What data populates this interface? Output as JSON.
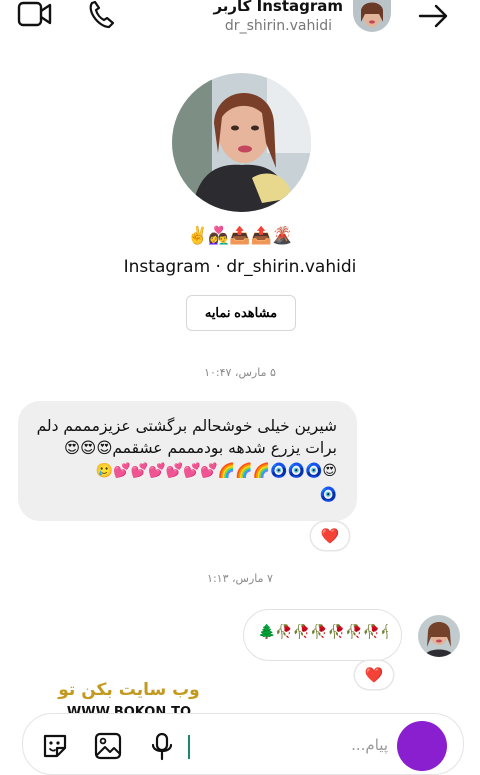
{
  "header": {
    "title": "Instagram کاربر",
    "username": "dr_shirin.vahidi"
  },
  "profile": {
    "emojis": "✌️👩‍❤️‍👨📤📤🌋",
    "line": "Instagram · dr_shirin.vahidi",
    "view_button": "مشاهده نمایه"
  },
  "messages": [
    {
      "date": "۵ مارس، ۱۰:۴۷",
      "lines": [
        "شیرین خیلی خوشحالم برگشتی عزیزمممم دلم",
        "برات یزرع شدهه بودمممم عشقمم😍😍😍",
        "😍🧿🧿🧿🌈🌈🌈💕💕💕💕💕💕🥲",
        "🧿"
      ],
      "reaction": "❤️"
    },
    {
      "date": "۷ مارس، ۱:۱۳",
      "text": "🌲🥀🥀🥀🥀🥀🥀🥀🥀",
      "reaction": "❤️"
    }
  ],
  "watermark": {
    "line1": "وب سایت بکن تو",
    "line2": "WWW.BOKON.TO"
  },
  "composer": {
    "placeholder": "پیام..."
  },
  "colors": {
    "accent": "#8a1fd0",
    "watermark_gold": "#c39a20"
  }
}
